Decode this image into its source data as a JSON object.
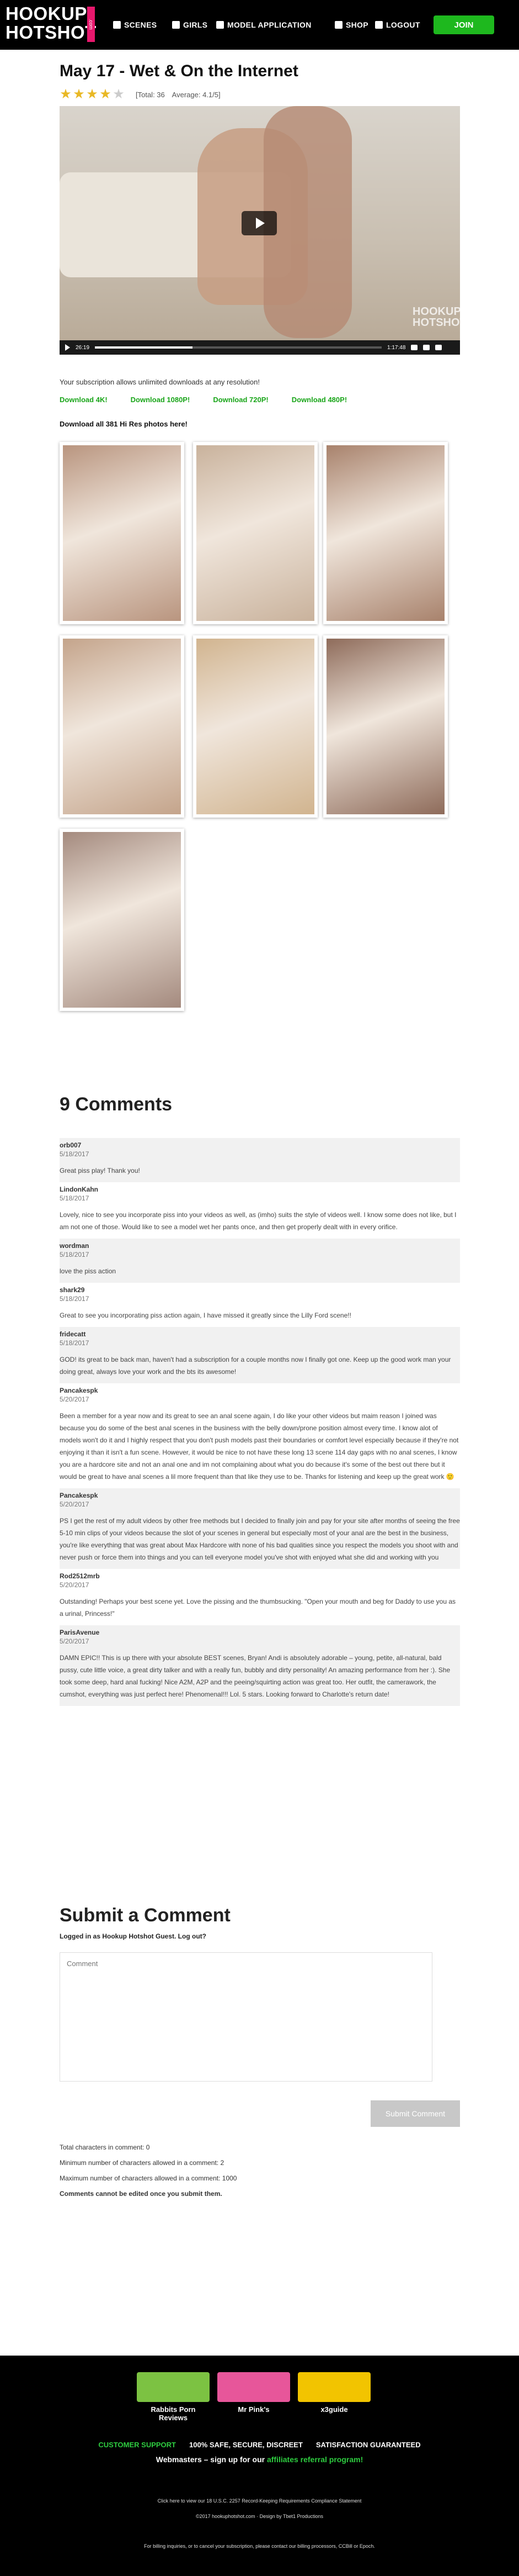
{
  "header": {
    "logo_line1": "HOOKUP",
    "logo_line2": "HOTSHOT",
    "logo_dotcom": ".com",
    "nav": {
      "scenes": "SCENES",
      "girls": "GIRLS",
      "model_application": "MODEL APPLICATION",
      "shop": "SHOP",
      "logout": "LOGOUT"
    },
    "join_label": "JOIN"
  },
  "scene": {
    "title": "May 17 - Wet & On the Internet",
    "rating": {
      "stars_filled": 4,
      "stars_total": 5,
      "total_label": "[Total: 36",
      "average_label": "Average: 4.1/5]"
    },
    "video": {
      "current_time": "26:19",
      "duration": "1:17:48",
      "progress": 0.34,
      "watermark_1": "HOOKUP",
      "watermark_2": "HOTSHOT"
    },
    "subscription_note": "Your subscription allows unlimited downloads at any resolution!",
    "downloads": [
      "Download 4K!",
      "Download 1080P!",
      "Download 720P!",
      "Download 480P!"
    ],
    "photos_link": "Download all 381 Hi Res photos here!"
  },
  "gallery": {
    "photo_count": 7,
    "swatches": [
      "#b9957f",
      "#c9b29c",
      "#a8826c",
      "#c4a48b",
      "#d1b48f",
      "#8e6b5a",
      "#a48a7e"
    ]
  },
  "comments": {
    "title": "9 Comments",
    "items": [
      {
        "author": "orb007",
        "date": "5/18/2017",
        "text": "Great piss play! Thank you!"
      },
      {
        "author": "LindonKahn",
        "date": "5/18/2017",
        "text": "Lovely, nice to see you incorporate piss into your videos as well, as (imho) suits the style of videos well. I know some does not like, but I am not one of those. Would like to see a model wet her pants once, and then get properly dealt with in every orifice."
      },
      {
        "author": "wordman",
        "date": "5/18/2017",
        "text": "love the piss action"
      },
      {
        "author": "shark29",
        "date": "5/18/2017",
        "text": "Great to see you incorporating piss action again, I have missed it greatly since the Lilly Ford scene!!"
      },
      {
        "author": "fridecatt",
        "date": "5/18/2017",
        "text": "GOD! its great to be back man, haven't had a subscription for a couple months now I finally got one. Keep up the good work man your doing great, always love your work and the bts its awesome!"
      },
      {
        "author": "Pancakespk",
        "date": "5/20/2017",
        "text": "Been a member for a year now and its great to see an anal scene again, I do like your other videos but maim reason I joined was because you do some of the best anal scenes in the business with the belly down/prone position almost every time. I know alot of models won't do it and I highly respect that you don't push models past their boundaries or comfort level especially because if they're not enjoying it than it isn't a fun scene. However, it would be nice to not have these long 13 scene 114 day gaps with no anal scenes, I know you are a hardcore site and not an anal one and im not complaining about what you do because it's some of the best out there but it would be great to have anal scenes a lil more frequent than that like they use to be. Thanks for listening and keep up the great work 🙂"
      },
      {
        "author": "Pancakespk",
        "date": "5/20/2017",
        "text": "PS I get the rest of my adult videos by other free methods but I decided to finally join and pay for your site after months of seeing the free 5-10 min clips of your videos because the slot of your scenes in general but especially most of your anal are the best in the business, you're like everything that was great about Max Hardcore with none of his bad qualities since you respect the models you shoot with and never push or force them into things and you can tell everyone model you've shot with enjoyed what she did and working with you"
      },
      {
        "author": "Rod2512mrb",
        "date": "5/20/2017",
        "text": "Outstanding! Perhaps your best scene yet. Love the pissing and the thumbsucking. \"Open your mouth and beg for Daddy to use you as a urinal, Princess!\""
      },
      {
        "author": "ParisAvenue",
        "date": "5/20/2017",
        "text": "DAMN EPIC!! This is up there with your absolute BEST scenes, Bryan! Andi is absolutely adorable – young, petite, all-natural, bald pussy, cute little voice, a great dirty talker and with a really fun, bubbly and dirty personality! An amazing performance from her :). She took some deep, hard anal fucking! Nice A2M, A2P and the peeing/squirting action was great too. Her outfit, the camerawork, the cumshot, everything was just perfect here! Phenomenal!!! Lol. 5 stars. Looking forward to Charlotte's return date!"
      }
    ]
  },
  "submit": {
    "title": "Submit a Comment",
    "logged_in": "Logged in as Hookup Hotshot Guest. Log out?",
    "placeholder": "Comment",
    "button_label": "Submit Comment",
    "total_chars": "Total characters in comment: 0",
    "min_chars": "Minimum number of characters allowed in a comment: 2",
    "max_chars": "Maximum number of characters allowed in a comment: 1000",
    "edit_note": "Comments cannot be edited once you submit them."
  },
  "footer": {
    "partners": [
      {
        "label": "Rabbits Porn Reviews",
        "color": "#7cc242"
      },
      {
        "label": "Mr Pink's",
        "color": "#e7569a"
      },
      {
        "label": "x3guide",
        "color": "#f2c400"
      }
    ],
    "trust": [
      "CUSTOMER SUPPORT",
      "100% SAFE, SECURE, DISCREET",
      "SATISFACTION GUARANTEED"
    ],
    "webmasters_prefix": "Webmasters – sign up for our",
    "webmasters_link": "affiliates referral program!",
    "compliance": "Click here to view our 18 U.S.C. 2257 Record-Keeping Requirements Compliance Statement",
    "copyright": "©2017 hookuphotshot.com · Design by Tbet1 Productions",
    "billing": "For billing inquiries, or to cancel your subscription, please contact our billing processors, CCBill or Epoch."
  }
}
